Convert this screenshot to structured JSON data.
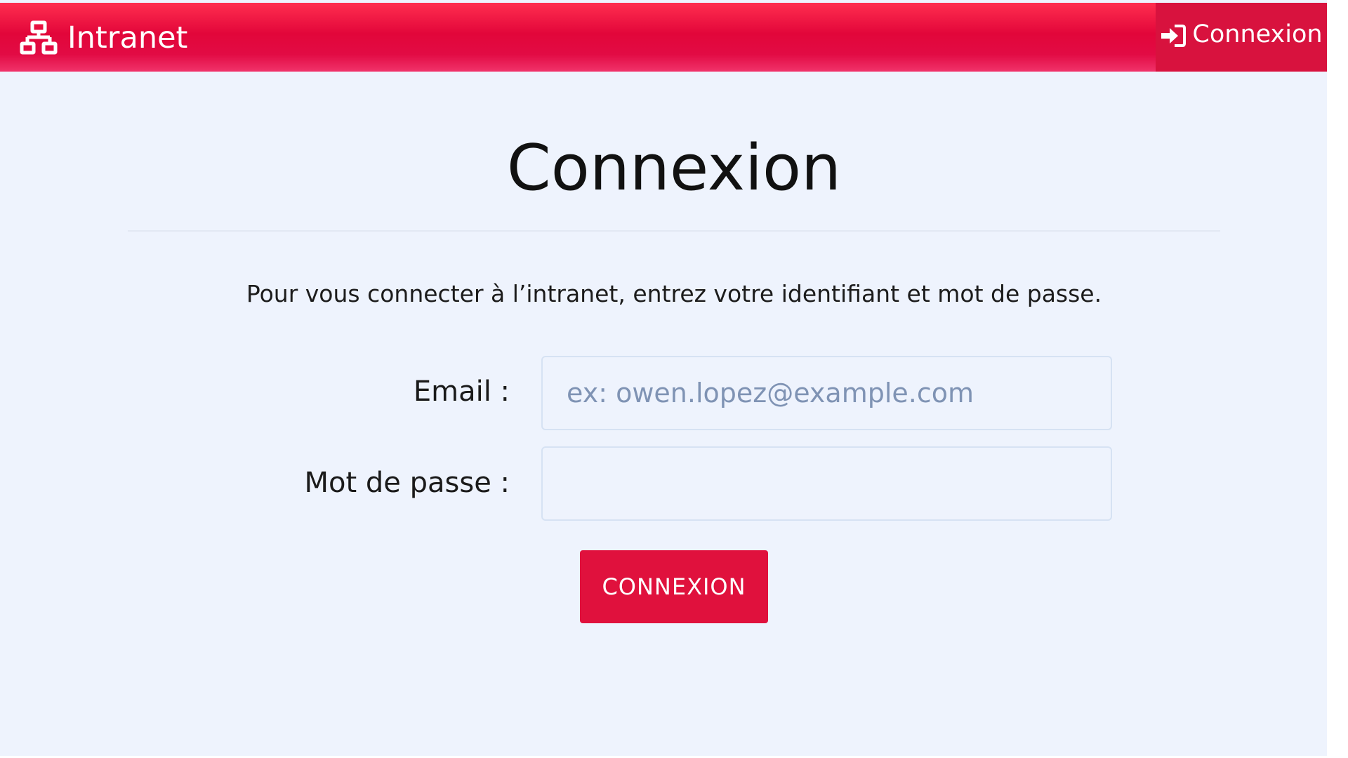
{
  "navbar": {
    "brand_name": "Intranet",
    "brand_icon": "sitemap-icon",
    "login_label": "Connexion",
    "login_icon": "sign-in-icon"
  },
  "main": {
    "title": "Connexion",
    "intro": "Pour vous connecter à l’intranet, entrez votre identifiant et mot de passe."
  },
  "form": {
    "email_label": "Email :",
    "email_placeholder": "ex: owen.lopez@example.com",
    "email_value": "",
    "password_label": "Mot de passe :",
    "password_value": "",
    "submit_label": "CONNEXION"
  },
  "colors": {
    "brand_red": "#e20b44",
    "button_red": "#e0113d",
    "background": "#eef3fd",
    "placeholder": "#7f93b4"
  }
}
